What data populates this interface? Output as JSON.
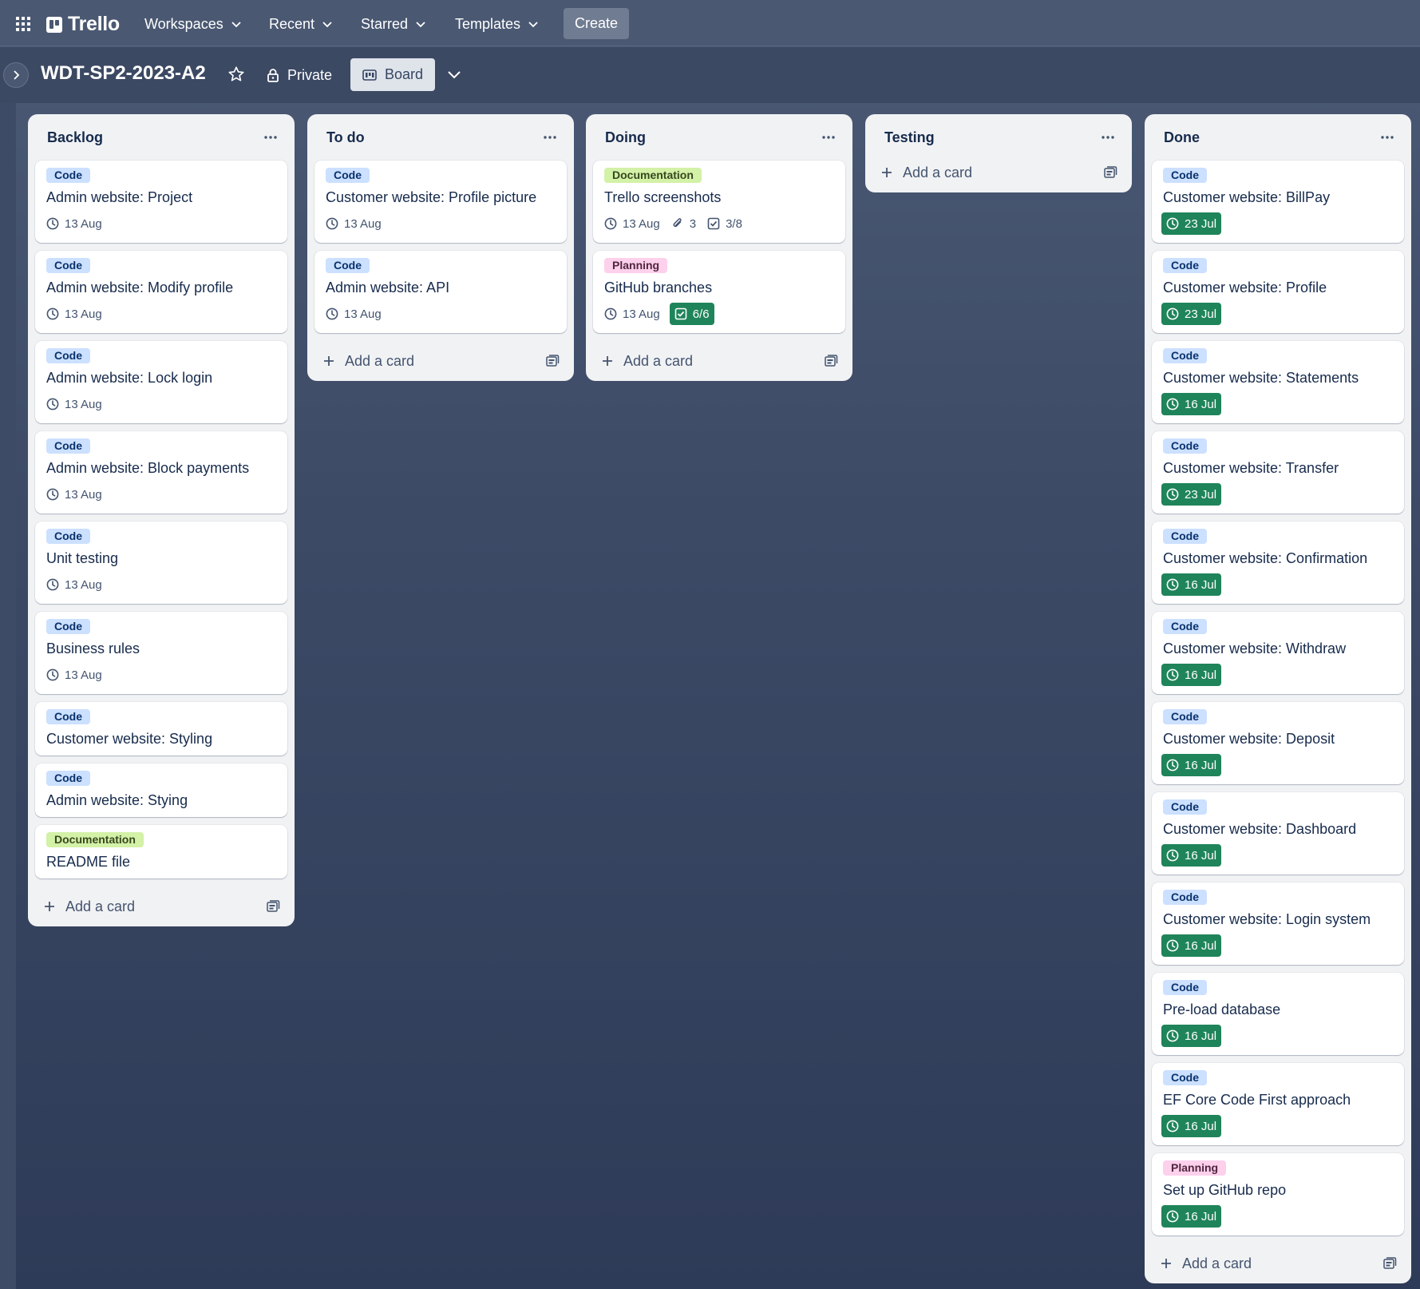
{
  "topnav": {
    "logo": "Trello",
    "workspaces": "Workspaces",
    "recent": "Recent",
    "starred": "Starred",
    "templates": "Templates",
    "create": "Create"
  },
  "board": {
    "title": "WDT-SP2-2023-A2",
    "visibility": "Private",
    "view": "Board"
  },
  "add_card_label": "Add a card",
  "lists": [
    {
      "title": "Backlog",
      "cards": [
        {
          "label": "Code",
          "title": "Admin website: Project",
          "due": "13 Aug"
        },
        {
          "label": "Code",
          "title": "Admin website: Modify profile",
          "due": "13 Aug"
        },
        {
          "label": "Code",
          "title": "Admin website: Lock login",
          "due": "13 Aug"
        },
        {
          "label": "Code",
          "title": "Admin website: Block payments",
          "due": "13 Aug"
        },
        {
          "label": "Code",
          "title": "Unit testing",
          "due": "13 Aug"
        },
        {
          "label": "Code",
          "title": "Business rules",
          "due": "13 Aug"
        },
        {
          "label": "Code",
          "title": "Customer website: Styling"
        },
        {
          "label": "Code",
          "title": "Admin website: Stying"
        },
        {
          "label": "Documentation",
          "title": "README file"
        }
      ]
    },
    {
      "title": "To do",
      "cards": [
        {
          "label": "Code",
          "title": "Customer website: Profile picture",
          "due": "13 Aug"
        },
        {
          "label": "Code",
          "title": "Admin website: API",
          "due": "13 Aug"
        }
      ]
    },
    {
      "title": "Doing",
      "cards": [
        {
          "label": "Documentation",
          "title": "Trello screenshots",
          "due": "13 Aug",
          "attachments": "3",
          "checklist": "3/8"
        },
        {
          "label": "Planning",
          "title": "GitHub branches",
          "due": "13 Aug",
          "checklist": "6/6",
          "checklist_complete": true
        }
      ]
    },
    {
      "title": "Testing",
      "cards": []
    },
    {
      "title": "Done",
      "cards": [
        {
          "label": "Code",
          "title": "Customer website: BillPay",
          "due": "23 Jul",
          "due_complete": true
        },
        {
          "label": "Code",
          "title": "Customer website: Profile",
          "due": "23 Jul",
          "due_complete": true
        },
        {
          "label": "Code",
          "title": "Customer website: Statements",
          "due": "16 Jul",
          "due_complete": true
        },
        {
          "label": "Code",
          "title": "Customer website: Transfer",
          "due": "23 Jul",
          "due_complete": true
        },
        {
          "label": "Code",
          "title": "Customer website: Confirmation",
          "due": "16 Jul",
          "due_complete": true
        },
        {
          "label": "Code",
          "title": "Customer website: Withdraw",
          "due": "16 Jul",
          "due_complete": true
        },
        {
          "label": "Code",
          "title": "Customer website: Deposit",
          "due": "16 Jul",
          "due_complete": true
        },
        {
          "label": "Code",
          "title": "Customer website: Dashboard",
          "due": "16 Jul",
          "due_complete": true
        },
        {
          "label": "Code",
          "title": "Customer website: Login system",
          "due": "16 Jul",
          "due_complete": true
        },
        {
          "label": "Code",
          "title": "Pre-load database",
          "due": "16 Jul",
          "due_complete": true
        },
        {
          "label": "Code",
          "title": "EF Core Code First approach",
          "due": "16 Jul",
          "due_complete": true
        },
        {
          "label": "Planning",
          "title": "Set up GitHub repo",
          "due": "16 Jul",
          "due_complete": true
        }
      ]
    }
  ],
  "colors": {
    "label_code": "#cce0ff",
    "label_documentation": "#d3f1a7",
    "label_planning": "#fdd0ec",
    "due_complete": "#1f845a"
  }
}
